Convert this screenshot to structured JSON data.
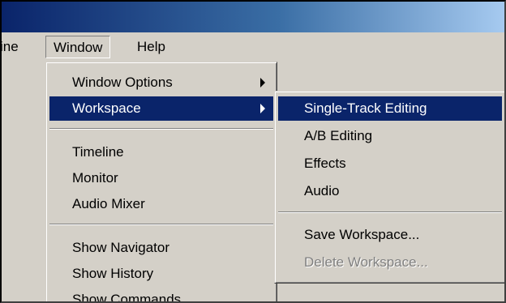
{
  "menubar": {
    "items": [
      {
        "label": "ine"
      },
      {
        "label": "Window"
      },
      {
        "label": "Help"
      }
    ]
  },
  "window_menu": {
    "items": [
      {
        "label": "Window Options"
      },
      {
        "label": "Workspace"
      },
      {
        "label": "Timeline"
      },
      {
        "label": "Monitor"
      },
      {
        "label": "Audio Mixer"
      },
      {
        "label": "Show Navigator"
      },
      {
        "label": "Show History"
      },
      {
        "label": "Show Commands"
      }
    ]
  },
  "workspace_menu": {
    "items": [
      {
        "label": "Single-Track Editing"
      },
      {
        "label": "A/B Editing"
      },
      {
        "label": "Effects"
      },
      {
        "label": "Audio"
      },
      {
        "label": "Save Workspace..."
      },
      {
        "label": "Delete Workspace..."
      }
    ]
  },
  "colors": {
    "highlight": "#0a246a",
    "menu_bg": "#d4d0c8",
    "disabled_text": "#808080"
  },
  "icons": {
    "submenu_arrow": "triangle-right"
  }
}
